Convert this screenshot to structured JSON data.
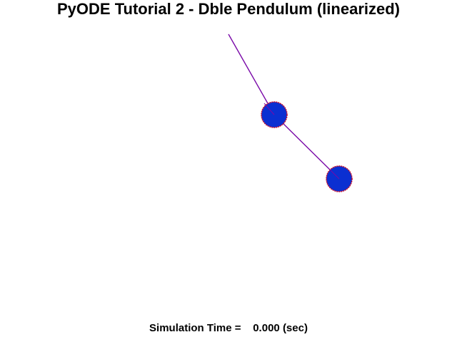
{
  "window": {
    "title": "PyODE Tutorial 2 - Dble Pendulum (linearized)"
  },
  "status": {
    "label": "Simulation Time = ",
    "value": "0.000",
    "unit": "(sec)"
  },
  "colors": {
    "rod": "#7a0aa8",
    "bob_fill": "#0b2fd1",
    "bob_outline": "#c8102e",
    "text": "#000000",
    "background": "#ffffff"
  }
}
